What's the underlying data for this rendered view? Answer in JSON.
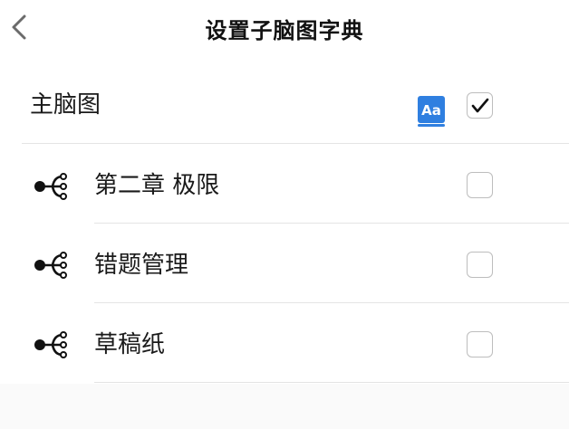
{
  "header": {
    "title": "设置子脑图字典"
  },
  "main_row": {
    "label": "主脑图",
    "checked": true
  },
  "items": [
    {
      "label": "第二章 极限",
      "checked": false
    },
    {
      "label": "错题管理",
      "checked": false
    },
    {
      "label": "草稿纸",
      "checked": false
    }
  ],
  "colors": {
    "accent": "#2f7fe0",
    "divider": "#e4e4e4"
  },
  "icons": {
    "back": "chevron-left-icon",
    "dictionary": "dictionary-icon",
    "branch": "mindmap-branch-icon",
    "check": "checkmark-icon"
  }
}
